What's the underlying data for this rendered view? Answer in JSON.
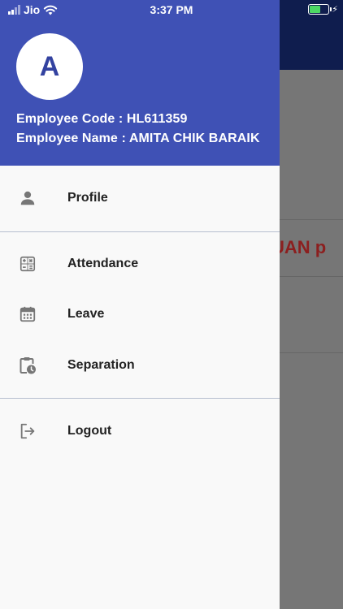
{
  "status_bar": {
    "carrier": "Jio",
    "time": "3:37 PM",
    "battery_level": 0.6
  },
  "drawer": {
    "avatar_letter": "A",
    "employee_code_line": "Employee Code : HL611359",
    "employee_name_line": "Employee Name : AMITA CHIK BARAIK",
    "items": [
      {
        "label": "Profile",
        "icon": "person-icon"
      },
      {
        "label": "Attendance",
        "icon": "calculator-icon"
      },
      {
        "label": "Leave",
        "icon": "calendar-icon"
      },
      {
        "label": "Separation",
        "icon": "clipboard-clock-icon"
      },
      {
        "label": "Logout",
        "icon": "logout-icon"
      }
    ]
  },
  "background": {
    "partial_text": "UAN p"
  },
  "colors": {
    "header": "#3f51b5",
    "app_bar": "#0f1d4e",
    "accent_text": "#8c1f1f"
  }
}
